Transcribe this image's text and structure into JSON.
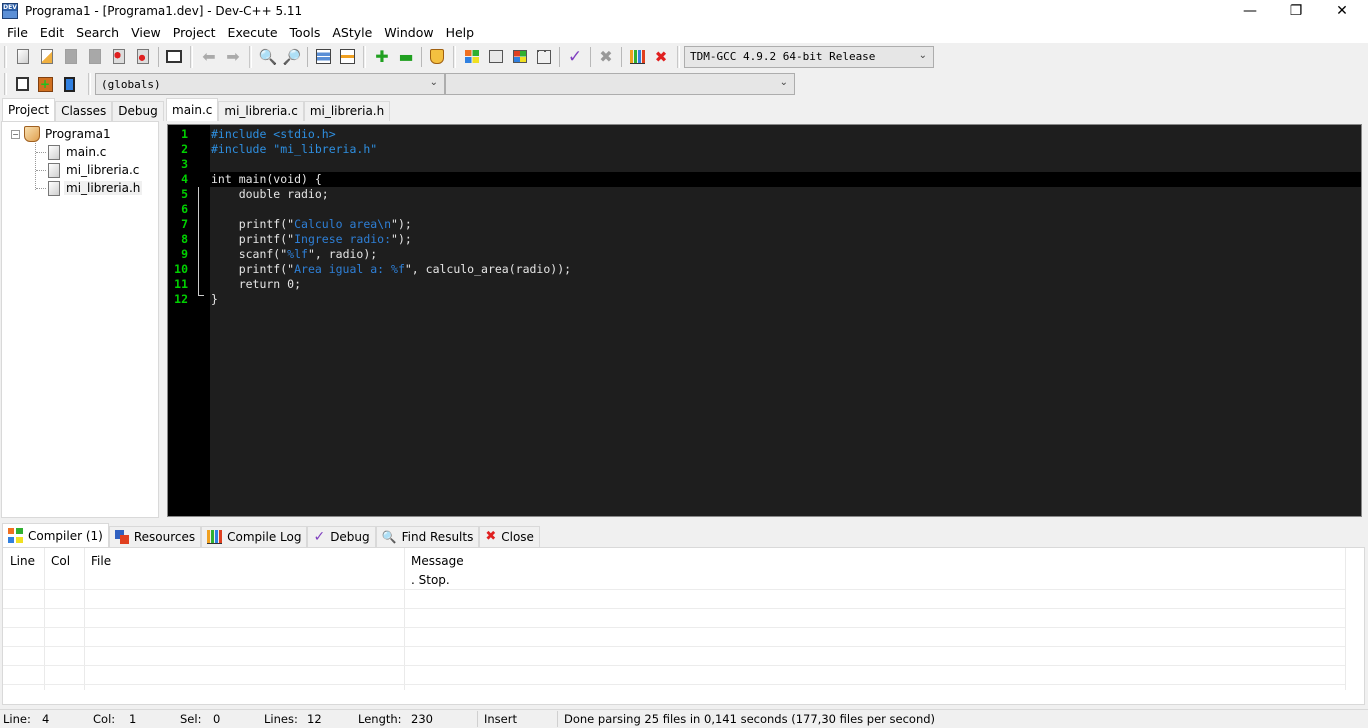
{
  "window": {
    "title": "Programa1 - [Programa1.dev] - Dev-C++ 5.11",
    "app_icon_label": "DEV",
    "controls": {
      "minimize": "—",
      "restore": "❐",
      "close": "✕"
    }
  },
  "menubar": [
    "File",
    "Edit",
    "Search",
    "View",
    "Project",
    "Execute",
    "Tools",
    "AStyle",
    "Window",
    "Help"
  ],
  "toolbar": {
    "compiler_select": "TDM-GCC 4.9.2 64-bit Release",
    "scope_select": "(globals)",
    "function_select": "",
    "icons": [
      "new-file-icon",
      "open-project-icon",
      "save-icon",
      "save-all-icon",
      "close-file-icon",
      "close-all-icon",
      "print-icon",
      "undo-icon",
      "redo-icon",
      "find-icon",
      "replace-icon",
      "indent-icon",
      "unindent-icon",
      "add-to-project-icon",
      "remove-from-project-icon",
      "project-options-icon",
      "compile-icon",
      "run-icon",
      "compile-run-icon",
      "rebuild-icon",
      "syntax-check-icon",
      "stop-execution-icon",
      "profile-icon",
      "delete-profile-icon",
      "goto-icon",
      "insert-icon",
      "toggle-bookmark-icon"
    ]
  },
  "left_panel": {
    "tabs": [
      "Project",
      "Classes",
      "Debug"
    ],
    "active_tab": "Project",
    "tree": {
      "project": "Programa1",
      "files": [
        "main.c",
        "mi_libreria.c",
        "mi_libreria.h"
      ],
      "selected": "mi_libreria.h"
    }
  },
  "editor": {
    "tabs": [
      "main.c",
      "mi_libreria.c",
      "mi_libreria.h"
    ],
    "active_tab": "main.c",
    "current_line": 4,
    "lines": [
      {
        "n": "1",
        "code": "#include <stdio.h>"
      },
      {
        "n": "2",
        "code": "#include \"mi_libreria.h\""
      },
      {
        "n": "3",
        "code": ""
      },
      {
        "n": "4",
        "code": "int main(void) {"
      },
      {
        "n": "5",
        "code": "    double radio;"
      },
      {
        "n": "6",
        "code": ""
      },
      {
        "n": "7",
        "code": "    printf(\"Calculo area\\n\");"
      },
      {
        "n": "8",
        "code": "    printf(\"Ingrese radio:\");"
      },
      {
        "n": "9",
        "code": "    scanf(\"%lf\", radio);"
      },
      {
        "n": "10",
        "code": "    printf(\"Area igual a: %f\", calculo_area(radio));"
      },
      {
        "n": "11",
        "code": "    return 0;"
      },
      {
        "n": "12",
        "code": "}"
      }
    ],
    "colors": {
      "background": "#1e1e1e",
      "gutter": "#000000",
      "line_numbers": "#00d000",
      "preprocessor": "#2e8fe0",
      "string": "#2e7fd6",
      "text": "#e6e6e6"
    }
  },
  "bottom_panel": {
    "tabs": [
      {
        "label": "Compiler (1)",
        "icon": "compiler-icon"
      },
      {
        "label": "Resources",
        "icon": "resources-icon"
      },
      {
        "label": "Compile Log",
        "icon": "compile-log-icon"
      },
      {
        "label": "Debug",
        "icon": "debug-check-icon"
      },
      {
        "label": "Find Results",
        "icon": "find-results-icon"
      },
      {
        "label": "Close",
        "icon": "close-panel-icon"
      }
    ],
    "active_tab": "Compiler (1)",
    "columns": [
      "Line",
      "Col",
      "File",
      "Message"
    ],
    "rows": [
      {
        "line": "",
        "col": "",
        "file": "",
        "message": ". Stop."
      }
    ]
  },
  "statusbar": {
    "line_label": "Line:",
    "line": "4",
    "col_label": "Col:",
    "col": "1",
    "sel_label": "Sel:",
    "sel": "0",
    "lines_label": "Lines:",
    "lines": "12",
    "length_label": "Length:",
    "length": "230",
    "mode": "Insert",
    "message": "Done parsing 25 files in 0,141 seconds (177,30 files per second)"
  }
}
